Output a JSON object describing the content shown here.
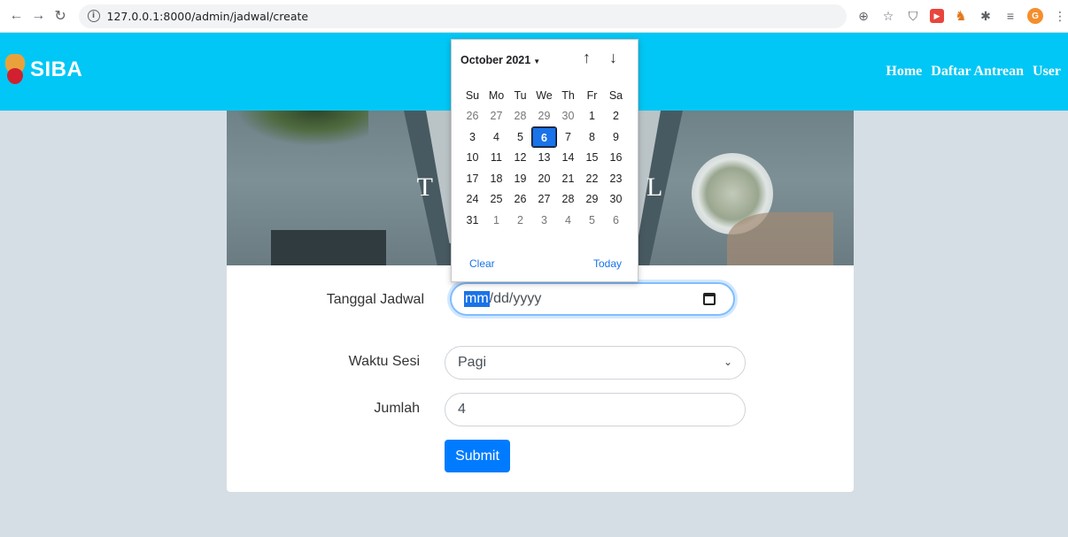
{
  "browser": {
    "url": "127.0.0.1:8000/admin/jadwal/create"
  },
  "app": {
    "brand": "SIBA",
    "nav": [
      "Home",
      "Daftar Antrean",
      "User"
    ]
  },
  "hero": {
    "title_left": "T",
    "title_right": "L"
  },
  "form": {
    "date_label": "Tanggal Jadwal",
    "date_placeholder_mm": "mm",
    "date_placeholder_rest": "/dd/yyyy",
    "session_label": "Waktu Sesi",
    "session_value": "Pagi",
    "amount_label": "Jumlah",
    "amount_value": "4",
    "submit_label": "Submit"
  },
  "datepicker": {
    "month_label": "October 2021",
    "weekdays": [
      "Su",
      "Mo",
      "Tu",
      "We",
      "Th",
      "Fr",
      "Sa"
    ],
    "weeks": [
      [
        "26",
        "27",
        "28",
        "29",
        "30",
        "1",
        "2"
      ],
      [
        "3",
        "4",
        "5",
        "6",
        "7",
        "8",
        "9"
      ],
      [
        "10",
        "11",
        "12",
        "13",
        "14",
        "15",
        "16"
      ],
      [
        "17",
        "18",
        "19",
        "20",
        "21",
        "22",
        "23"
      ],
      [
        "24",
        "25",
        "26",
        "27",
        "28",
        "29",
        "30"
      ],
      [
        "31",
        "1",
        "2",
        "3",
        "4",
        "5",
        "6"
      ]
    ],
    "selected_day": "6",
    "clear_label": "Clear",
    "today_label": "Today"
  },
  "colors": {
    "appbar": "#00c7f5",
    "primary": "#007bff",
    "page_bg": "#d6dee5"
  }
}
